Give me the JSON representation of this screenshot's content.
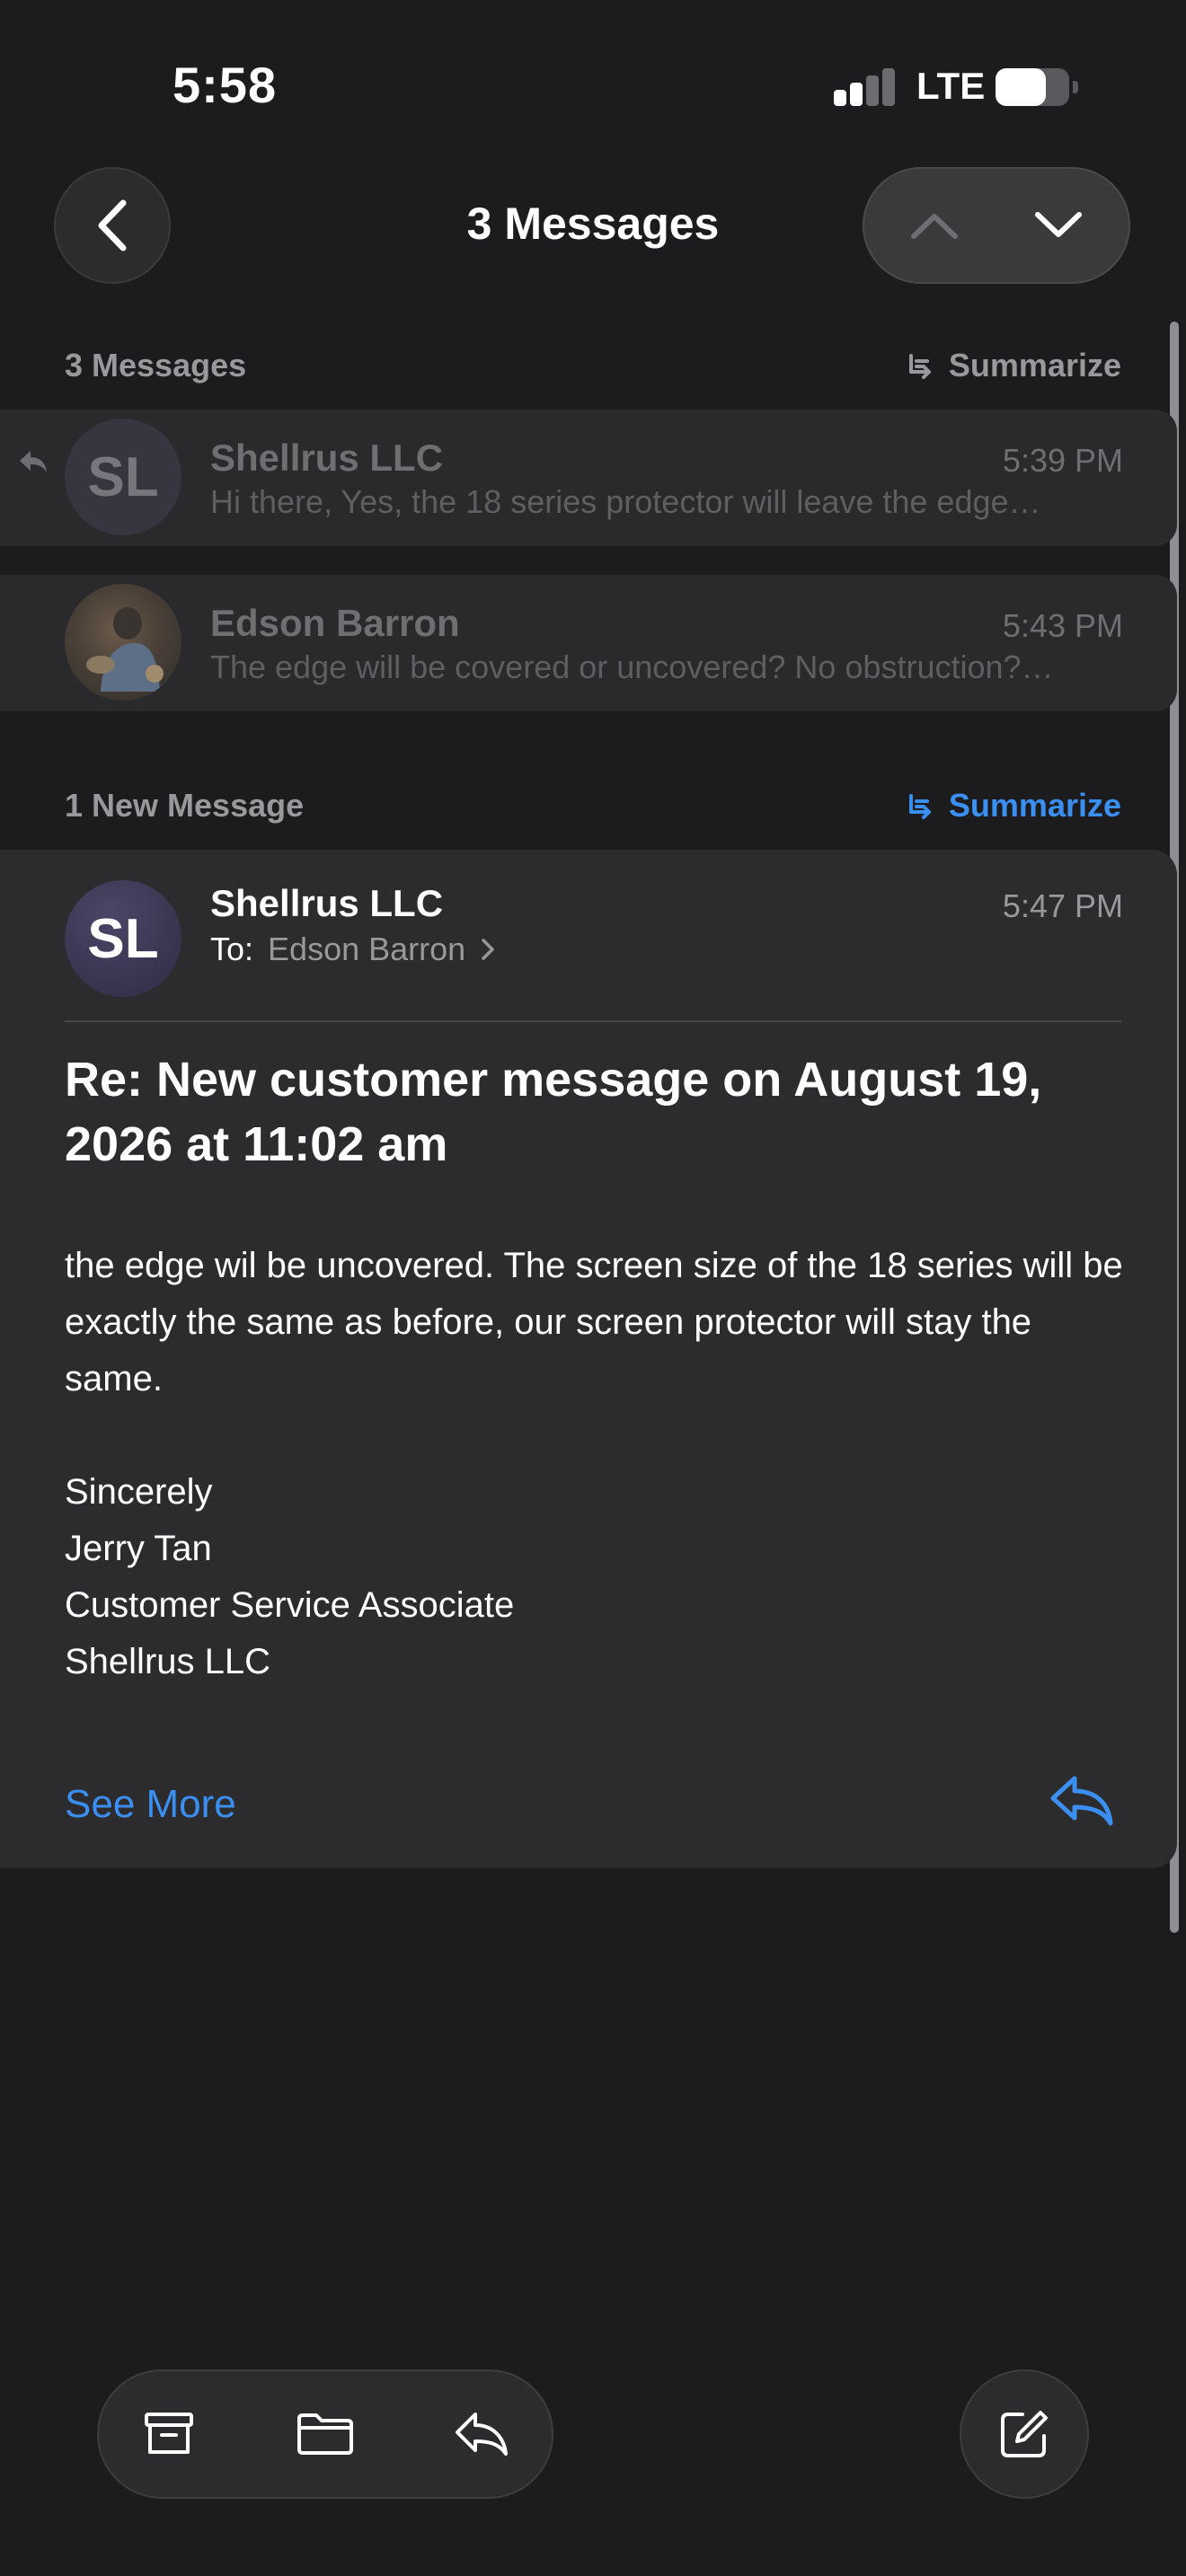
{
  "status_bar": {
    "time": "5:58",
    "network": "LTE"
  },
  "nav": {
    "title": "3 Messages"
  },
  "thread_section": {
    "label": "3 Messages",
    "summarize_label": "Summarize"
  },
  "messages": [
    {
      "sender": "Shellrus LLC",
      "initials": "SL",
      "time": "5:39 PM",
      "preview": "Hi there, Yes, the 18 series protector will leave the edge…"
    },
    {
      "sender": "Edson Barron",
      "time": "5:43 PM",
      "preview": "The edge will be covered or uncovered? No obstruction?…"
    }
  ],
  "new_section": {
    "label": "1 New Message",
    "summarize_label": "Summarize"
  },
  "expanded": {
    "sender": "Shellrus LLC",
    "initials": "SL",
    "time": "5:47 PM",
    "to_label": "To:",
    "to_name": "Edson Barron",
    "subject": "Re: New customer message on August 19, 2026 at 11:02 am",
    "body": "the edge wil be uncovered. The screen size of the 18 series will be exactly the same as before, our screen protector will stay the same.",
    "signature": [
      "Sincerely",
      "Jerry Tan",
      "Customer Service Associate",
      "Shellrus LLC"
    ],
    "see_more": "See More"
  },
  "colors": {
    "accent": "#3b8ff0",
    "background": "#1c1c1e",
    "card": "#2c2c2e"
  },
  "toolbar": {
    "icons": [
      "archive-icon",
      "folder-icon",
      "reply-icon"
    ],
    "compose_icon": "compose-icon"
  }
}
